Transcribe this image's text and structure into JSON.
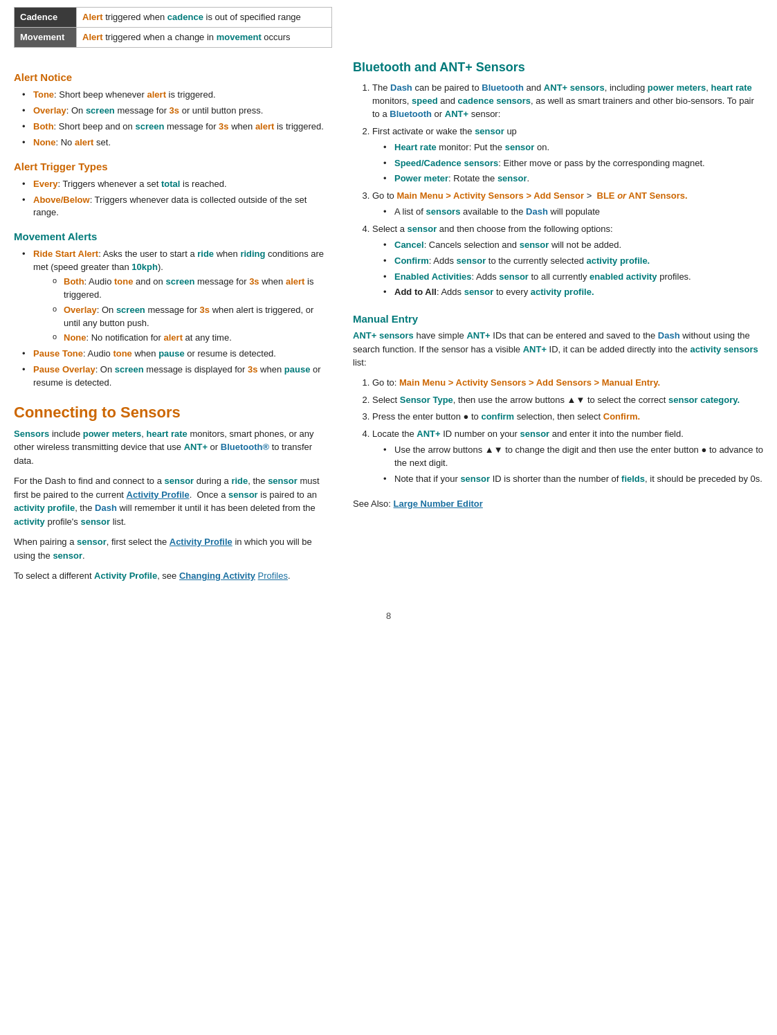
{
  "table": {
    "rows": [
      {
        "label": "Cadence",
        "text_before": "Alert triggered when ",
        "highlight1": "cadence",
        "text_after": " is out of specified range"
      },
      {
        "label": "Movement",
        "text_before": "Alert triggered when a change in ",
        "highlight1": "movement",
        "text_after": " occurs"
      }
    ]
  },
  "alert_notice": {
    "heading": "Alert Notice",
    "items": [
      {
        "label": "Tone",
        "text": ": Short beep whenever ",
        "keyword": "alert",
        "rest": " is triggered."
      },
      {
        "label": "Overlay",
        "text": ": On ",
        "keyword": "screen",
        "rest": " message for ",
        "keyword2": "3s",
        "rest2": " or until button press."
      },
      {
        "label": "Both",
        "text": ": Short beep and on ",
        "keyword": "screen",
        "rest": " message for ",
        "keyword2": "3s",
        "rest2": " when ",
        "keyword3": "alert",
        "rest3": " is triggered."
      },
      {
        "label": "None",
        "text": ": No ",
        "keyword": "alert",
        "rest": " set."
      }
    ]
  },
  "alert_trigger": {
    "heading": "Alert Trigger Types",
    "items": [
      {
        "label": "Every",
        "text": ": Triggers whenever a set ",
        "keyword": "total",
        "rest": " is reached."
      },
      {
        "label": "Above/Below",
        "text": ": Triggers whenever data is collected outside of the set range."
      }
    ]
  },
  "movement_alerts": {
    "heading": "Movement Alerts",
    "ride_start": {
      "label": "Ride Start Alert",
      "text": ": Asks the user to start a ",
      "keyword": "ride",
      "rest": " when ",
      "keyword2": "riding",
      "rest2": " conditions are met (speed greater than ",
      "keyword3": "10kph",
      "rest3": ")."
    },
    "sub_items": [
      {
        "bullet": "Both",
        "text": ": Audio ",
        "k1": "tone",
        "t1": " and on ",
        "k2": "screen",
        "t2": " message for ",
        "k3": "3s",
        "t3": " when ",
        "k4": "alert",
        "t4": " is triggered."
      },
      {
        "bullet": "Overlay",
        "text": ": On ",
        "k1": "screen",
        "t1": " message for ",
        "k2": "3s",
        "t2": " when alert is triggered, or until any button push."
      },
      {
        "bullet": "None",
        "text": ": No notification for ",
        "k1": "alert",
        "t1": " at any time."
      }
    ],
    "pause_tone": {
      "label": "Pause Tone",
      "text": ": Audio ",
      "k1": "tone",
      "t1": " when ",
      "k2": "pause",
      "t2": " or resume is detected."
    },
    "pause_overlay": {
      "label": "Pause Overlay",
      "text": ": On ",
      "k1": "screen",
      "t1": " message is displayed for ",
      "k2": "3s",
      "t2": " when ",
      "k3": "pause",
      "t3": " or resume is detected."
    }
  },
  "connecting": {
    "heading": "Connecting to Sensors",
    "para1_parts": [
      {
        "text": "Sensors",
        "color": "teal"
      },
      {
        "text": " include "
      },
      {
        "text": "power meters",
        "color": "teal"
      },
      {
        "text": ", "
      },
      {
        "text": "heart rate",
        "color": "teal"
      },
      {
        "text": " monitors, smart phones, or any other wireless transmitting device that use "
      },
      {
        "text": "ANT+",
        "color": "teal"
      },
      {
        "text": " or "
      },
      {
        "text": "Bluetooth®",
        "color": "blue"
      },
      {
        "text": " to transfer data."
      }
    ],
    "para2_parts": [
      {
        "text": "For the Dash to find and connect to a "
      },
      {
        "text": "sensor",
        "color": "teal"
      },
      {
        "text": " during a "
      },
      {
        "text": "ride",
        "color": "teal"
      },
      {
        "text": ", the "
      },
      {
        "text": "sensor",
        "color": "teal"
      },
      {
        "text": " must first be paired to the current "
      },
      {
        "text": "Activity Profile",
        "color": "teal",
        "underline": true
      },
      {
        "text": ".  Once a "
      },
      {
        "text": "sensor",
        "color": "teal"
      },
      {
        "text": " is paired to an "
      },
      {
        "text": "activity profile",
        "color": "teal"
      },
      {
        "text": ", the "
      },
      {
        "text": "Dash",
        "color": "blue"
      },
      {
        "text": " will remember it until it has been deleted from the "
      },
      {
        "text": "activity",
        "color": "teal"
      },
      {
        "text": " profile's "
      },
      {
        "text": "sensor",
        "color": "teal"
      },
      {
        "text": " list."
      }
    ],
    "para3_parts": [
      {
        "text": "When pairing a "
      },
      {
        "text": "sensor",
        "color": "teal"
      },
      {
        "text": ", first select the "
      },
      {
        "text": "Activity Profile",
        "color": "teal",
        "underline": true
      },
      {
        "text": " in which you will be using the "
      },
      {
        "text": "sensor",
        "color": "teal"
      },
      {
        "text": "."
      }
    ],
    "para4_parts": [
      {
        "text": "To select a different "
      },
      {
        "text": "Activity Profile",
        "color": "teal"
      },
      {
        "text": ", see "
      },
      {
        "text": "Changing Activity",
        "color": "blue",
        "underline": true
      },
      {
        "text": " "
      },
      {
        "text": "Profiles",
        "underline": true
      },
      {
        "text": "."
      }
    ]
  },
  "bluetooth": {
    "heading": "Bluetooth and ANT+ Sensors",
    "step1": {
      "text_parts": [
        {
          "text": "The "
        },
        {
          "text": "Dash",
          "color": "blue"
        },
        {
          "text": " can be paired to "
        },
        {
          "text": "Bluetooth",
          "color": "blue"
        },
        {
          "text": " and "
        },
        {
          "text": "ANT+ sensors",
          "color": "teal"
        },
        {
          "text": ", including "
        },
        {
          "text": "power meters",
          "color": "teal"
        },
        {
          "text": ", "
        },
        {
          "text": "heart rate",
          "color": "teal"
        },
        {
          "text": " monitors, "
        },
        {
          "text": "speed",
          "color": "teal"
        },
        {
          "text": " and "
        },
        {
          "text": "cadence sensors",
          "color": "teal"
        },
        {
          "text": ", as well as smart trainers and other bio-sensors. To pair to a "
        },
        {
          "text": "Bluetooth",
          "color": "blue"
        },
        {
          "text": " or "
        },
        {
          "text": "ANT+",
          "color": "teal"
        },
        {
          "text": " sensor:"
        }
      ],
      "sub_items": [
        {
          "parts": [
            {
              "text": "Heart rate",
              "color": "teal"
            },
            {
              "text": " monitor: Put the "
            },
            {
              "text": "sensor",
              "color": "teal"
            },
            {
              "text": " on."
            }
          ]
        },
        {
          "parts": [
            {
              "text": "Speed/Cadence sensors",
              "color": "teal"
            },
            {
              "text": ": Either move or pass by the corresponding magnet."
            }
          ]
        },
        {
          "parts": [
            {
              "text": "Power meter",
              "color": "teal"
            },
            {
              "text": ": Rotate the "
            },
            {
              "text": "sensor",
              "color": "teal"
            },
            {
              "text": "."
            }
          ]
        }
      ]
    },
    "step2": {
      "parts": [
        {
          "text": "First activate or wake the "
        },
        {
          "text": "sensor",
          "color": "teal"
        },
        {
          "text": " up"
        }
      ]
    },
    "step3": {
      "parts": [
        {
          "text": "Go to "
        },
        {
          "text": "Main Menu > Activity Sensors > Add Sensor",
          "color": "orange",
          "bold": true
        },
        {
          "text": " > "
        },
        {
          "text": " BLE ",
          "color": "orange",
          "bold": true
        },
        {
          "text": "or",
          "italic": true,
          "bold": true
        },
        {
          "text": " ANT Sensors.",
          "color": "orange",
          "bold": true
        }
      ],
      "sub_items": [
        {
          "parts": [
            {
              "text": "A list of "
            },
            {
              "text": "sensors",
              "color": "teal"
            },
            {
              "text": " available to the "
            },
            {
              "text": "Dash",
              "color": "blue"
            },
            {
              "text": " will populate"
            }
          ]
        }
      ]
    },
    "step4": {
      "parts": [
        {
          "text": "Select a "
        },
        {
          "text": "sensor",
          "color": "teal"
        },
        {
          "text": " and then choose from the following options:"
        }
      ],
      "sub_items": [
        {
          "label": "Cancel",
          "label_color": "teal",
          "parts": [
            {
              "text": ": Cancels selection and "
            },
            {
              "text": "sensor",
              "color": "teal"
            },
            {
              "text": " will not be added."
            }
          ]
        },
        {
          "label": "Confirm",
          "label_color": "teal",
          "parts": [
            {
              "text": ": Adds "
            },
            {
              "text": "sensor",
              "color": "teal"
            },
            {
              "text": " to the currently selected "
            },
            {
              "text": "activity profile.",
              "color": "teal"
            }
          ]
        },
        {
          "label": "Enabled Activities",
          "label_color": "teal",
          "parts": [
            {
              "text": ": Adds "
            },
            {
              "text": "sensor",
              "color": "teal"
            },
            {
              "text": " to all currently "
            },
            {
              "text": "enabled activity",
              "color": "teal"
            },
            {
              "text": " profiles."
            }
          ]
        },
        {
          "label": "Add to All",
          "parts": [
            {
              "text": ": Adds "
            },
            {
              "text": "sensor",
              "color": "teal"
            },
            {
              "text": " to every "
            },
            {
              "text": "activity profile.",
              "color": "teal"
            }
          ]
        }
      ]
    }
  },
  "manual_entry": {
    "heading": "Manual Entry",
    "intro_parts": [
      {
        "text": "ANT+ sensors",
        "color": "teal"
      },
      {
        "text": " have simple "
      },
      {
        "text": "ANT+",
        "color": "teal"
      },
      {
        "text": " IDs that can be entered and saved to the "
      },
      {
        "text": "Dash",
        "color": "blue"
      },
      {
        "text": " without using the search function. If the sensor has a visible "
      },
      {
        "text": "ANT+",
        "color": "teal"
      },
      {
        "text": " ID, it can be added directly into the "
      },
      {
        "text": "activity sensors",
        "color": "teal"
      },
      {
        "text": " list:"
      }
    ],
    "step1_parts": [
      {
        "text": "Go to: "
      },
      {
        "text": "Main Menu > Activity Sensors > Add Sensors > Manual Entry.",
        "color": "orange",
        "bold": true
      }
    ],
    "step2_parts": [
      {
        "text": "Select "
      },
      {
        "text": "Sensor Type",
        "color": "teal"
      },
      {
        "text": ", then use the arrow buttons ▲▼ to select the correct "
      },
      {
        "text": "sensor category.",
        "color": "teal"
      }
    ],
    "step3_parts": [
      {
        "text": "Press the enter button ● to "
      },
      {
        "text": "confirm",
        "color": "teal"
      },
      {
        "text": " selection, then select "
      },
      {
        "text": "Confirm.",
        "color": "orange",
        "bold": true
      }
    ],
    "step4_parts": [
      {
        "text": "Locate the "
      },
      {
        "text": "ANT+",
        "color": "teal"
      },
      {
        "text": " ID number on your "
      },
      {
        "text": "sensor",
        "color": "teal"
      },
      {
        "text": " and enter it into the number field."
      }
    ],
    "step4_sub": [
      {
        "parts": [
          {
            "text": "Use the arrow buttons ▲▼ to change the digit and then use the enter button ● to advance to the next digit."
          }
        ]
      },
      {
        "parts": [
          {
            "text": "Note that if your "
          },
          {
            "text": "sensor",
            "color": "teal"
          },
          {
            "text": " ID is shorter than the number of "
          },
          {
            "text": "fields",
            "color": "teal"
          },
          {
            "text": ", it should be preceded by 0s."
          }
        ]
      }
    ],
    "see_also": "See Also: ",
    "see_also_link": "Large Number Editor"
  },
  "page_number": "8",
  "activity_profiles_link": "Activity Profiles"
}
